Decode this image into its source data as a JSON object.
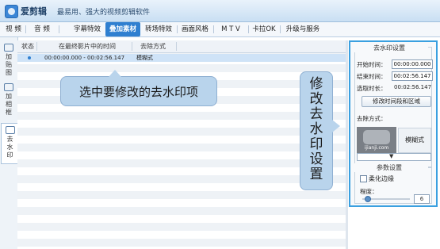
{
  "app": {
    "name": "爱剪辑",
    "slogan": "最易用、强大的视频剪辑软件"
  },
  "menu": [
    "视 频",
    "音 频",
    "字幕特效",
    "叠加素材",
    "转场特效",
    "画面风格",
    "M T V",
    "卡拉OK",
    "升级与服务"
  ],
  "menu_active_index": 3,
  "sidebar": {
    "tabs": [
      "加贴图",
      "加相框",
      "去水印"
    ],
    "active_index": 2
  },
  "table": {
    "headers": [
      "状态",
      "在最终影片中的时间",
      "去除方式"
    ],
    "rows": [
      {
        "time": "00:00:00.000 - 00:02:56.147",
        "method": "模糊式"
      }
    ]
  },
  "callouts": {
    "select": "选中要修改的去水印项",
    "modify": "修改去水印设置"
  },
  "panel": {
    "title": "去水印设置",
    "start_label": "开始时间：",
    "start_value": "00:00:00.000",
    "end_label": "结束时间：",
    "end_value": "00:02:56.147",
    "duration_label": "选取时长：",
    "duration_value": "00:02:56.147",
    "edit_button": "修改时间段和区域",
    "method_label": "去除方式：",
    "thumb_text": "ijianji.com",
    "mode_label": "模糊式",
    "dropdown_icon": "▼",
    "params_title": "参数设置",
    "soften_label": "柔化边缘",
    "degree_label": "程度：",
    "degree_value": "6",
    "degree_fraction": 0.1
  },
  "colors": {
    "accent": "#2f7fd0",
    "panel_border": "#3aa0e0",
    "callout": "#b9d4ec"
  }
}
